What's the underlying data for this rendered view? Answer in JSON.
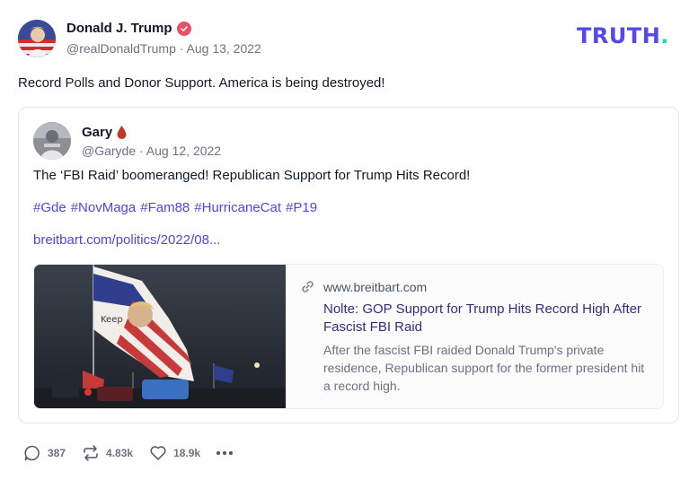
{
  "post": {
    "author": {
      "name": "Donald J. Trump",
      "handle": "@realDonaldTrump",
      "date": "Aug 13, 2022",
      "verified_color": "#e8506a"
    },
    "brand": {
      "logo_text": "TRUTH",
      "logo_dot": ".",
      "color": "#5448ee",
      "dot_color": "#17e0c0"
    },
    "text": "Record Polls and Donor Support. America is being destroyed!",
    "quote": {
      "author": {
        "name": "Gary",
        "handle": "@Garyde",
        "date": "Aug 12, 2022",
        "badge_icon": "blood-drop-icon"
      },
      "text": "The ‘FBI Raid’ boomeranged! Republican Support for Trump Hits Record!",
      "hashtags": [
        "#Gde",
        "#NovMaga",
        "#Fam88",
        "#HurricaneCat",
        "#P19"
      ],
      "link": "breitbart.com/politics/2022/08...",
      "link_card": {
        "domain": "www.breitbart.com",
        "title": "Nolte: GOP Support for Trump Hits Record High After Fascist FBI Raid",
        "description": "After the fascist FBI raided Donald Trump's private residence, Republican support for the former president hit a record high.",
        "image_flag_text": "Keep"
      }
    },
    "actions": {
      "replies": "387",
      "retruths": "4.83k",
      "likes": "18.9k",
      "icons": [
        "reply-icon",
        "retruth-icon",
        "like-icon",
        "more-icon"
      ]
    },
    "colors": {
      "link": "#4f46e5",
      "muted": "#6b7280",
      "text": "#111827"
    }
  }
}
